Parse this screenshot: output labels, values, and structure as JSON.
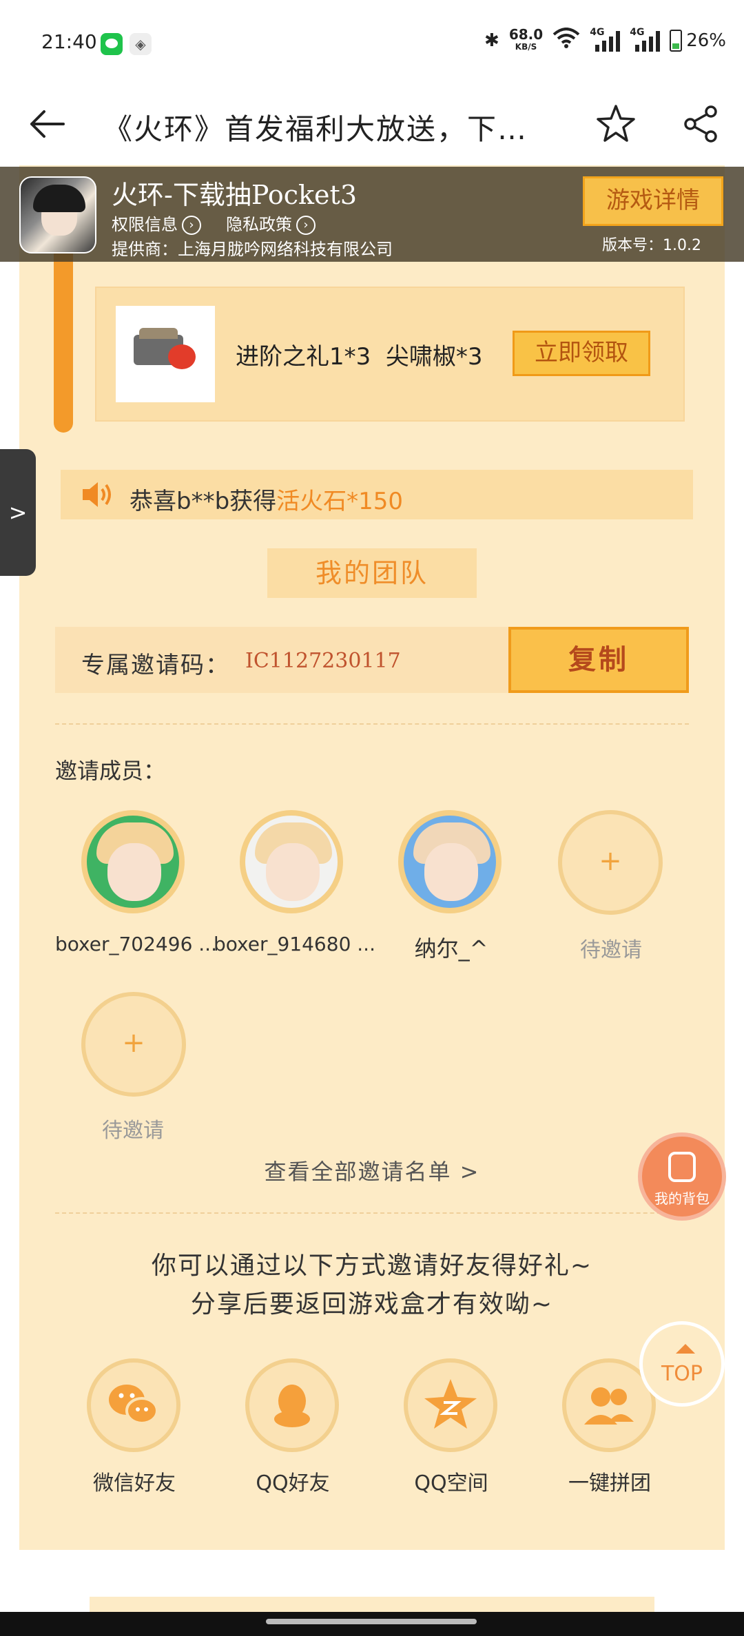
{
  "status_bar": {
    "time": "21:40",
    "speed_value": "68.0",
    "speed_unit": "KB/S",
    "net1": "4G",
    "net2": "4G",
    "battery": "26%"
  },
  "header": {
    "title": "《火环》首发福利大放送，下…"
  },
  "game_banner": {
    "name": "火环-下载抽Pocket3",
    "permissions": "权限信息",
    "privacy": "隐私政策",
    "provider": "提供商：上海月胧吟网络科技有限公司",
    "details_button": "游戏详情",
    "version": "版本号：1.0.2"
  },
  "reward": {
    "items_text": "进阶之礼1*3  尖啸椒*3",
    "claim_button": "立即领取"
  },
  "notice": {
    "prefix": "恭喜b**b获得",
    "item": "活火石",
    "suffix": "*150"
  },
  "team": {
    "title": "我的团队",
    "invite_code_label": "专属邀请码：",
    "invite_code": "IC1127230117",
    "copy_button": "复制",
    "members_label": "邀请成员：",
    "members": [
      {
        "name": "boxer_702496 ..."
      },
      {
        "name": "boxer_914680 ..."
      },
      {
        "name": "纳尔_^"
      },
      {
        "name": "待邀请"
      },
      {
        "name": "待邀请"
      }
    ],
    "view_all": "查看全部邀请名单 >"
  },
  "invite": {
    "line1": "你可以通过以下方式邀请好友得好礼~",
    "line2": "分享后要返回游戏盒才有效呦~",
    "channels": [
      {
        "label": "微信好友",
        "icon": "wechat-icon"
      },
      {
        "label": "QQ好友",
        "icon": "qq-icon"
      },
      {
        "label": "QQ空间",
        "icon": "qzone-icon"
      },
      {
        "label": "一键拼团",
        "icon": "group-icon"
      }
    ]
  },
  "floating": {
    "bag": "我的背包",
    "top": "TOP",
    "side": ">"
  },
  "colors": {
    "accent": "#f39a2a",
    "cream": "#fdebc6",
    "button": "#f9c246"
  }
}
